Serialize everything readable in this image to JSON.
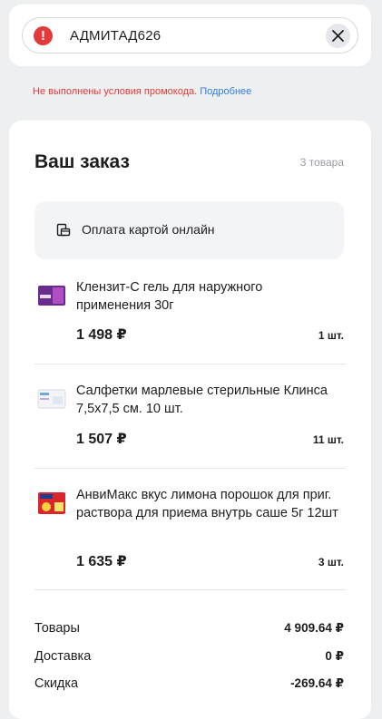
{
  "promo": {
    "code": "АДМИТАД626",
    "error": "Не выполнены условия промокода.",
    "more_link": "Подробнее"
  },
  "order": {
    "title": "Ваш заказ",
    "count": "3 товара",
    "payment_method": "Оплата картой онлайн",
    "items": [
      {
        "name": "Клензит-С гель для наружного применения 30г",
        "price": "1 498 ₽",
        "qty": "1 шт."
      },
      {
        "name": "Салфетки марлевые стерильные Клинса 7,5х7,5 см. 10 шт.",
        "price": "1 507 ₽",
        "qty": "11 шт."
      },
      {
        "name": "АнвиМакс вкус лимона порошок для приг. раствора для приема внутрь саше 5г 12шт",
        "price": "1 635 ₽",
        "qty": "3 шт."
      }
    ]
  },
  "summary": {
    "goods_label": "Товары",
    "goods_value": "4 909.64 ₽",
    "delivery_label": "Доставка",
    "delivery_value": "0 ₽",
    "discount_label": "Скидка",
    "discount_value": "-269.64 ₽"
  },
  "colors": {
    "error": "#e03a3a",
    "link": "#2f7de0",
    "card": "#ffffff",
    "background": "#eeeff1"
  }
}
